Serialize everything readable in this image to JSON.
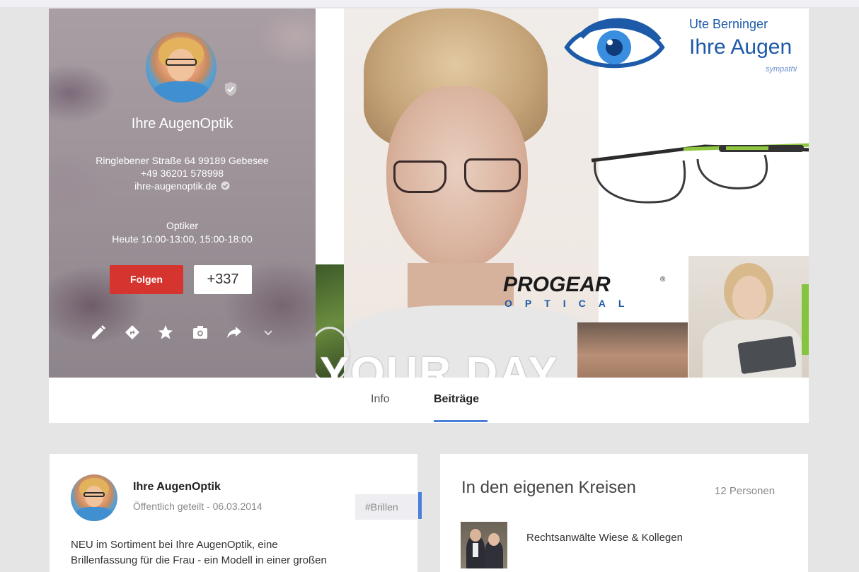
{
  "profile": {
    "name": "Ihre AugenOptik",
    "address": "Ringlebener Straße 64 99189 Gebesee",
    "phone": "+49 36201 578998",
    "website": "ihre-augenoptik.de",
    "category": "Optiker",
    "hours": "Heute 10:00-13:00, 15:00-18:00",
    "follow_label": "Folgen",
    "plus_count": "+337",
    "actions": [
      "edit-icon",
      "directions-icon",
      "star-icon",
      "camera-icon",
      "share-icon",
      "chevron-down-icon"
    ]
  },
  "cover": {
    "brand_line1": "Ute Berninger",
    "brand_line2": "Ihre Augen",
    "brand_line3": "sympathi",
    "progear_top": "PROGEAR",
    "progear_bottom": "OPTICAL",
    "progear_reg": "®",
    "slogan": "YOUR DAY"
  },
  "tabs": [
    {
      "label": "Info",
      "active": false
    },
    {
      "label": "Beiträge",
      "active": true
    }
  ],
  "post": {
    "author": "Ihre AugenOptik",
    "meta": "Öffentlich geteilt  -  06.03.2014",
    "hashtag": "#Brillen",
    "text_line1": "NEU im Sortiment bei Ihre AugenOptik, eine",
    "text_line2": "Brillenfassung für die Frau - ein Modell in einer großen"
  },
  "circles": {
    "title": "In den eigenen Kreisen",
    "count": "12 Personen",
    "person_name": "Rechtsanwälte Wiese & Kollegen"
  },
  "colors": {
    "follow_button": "#d6342e",
    "accent_blue": "#4a7fdc",
    "brand_blue": "#1d5aa8",
    "page_bg": "#e5e5e5"
  }
}
